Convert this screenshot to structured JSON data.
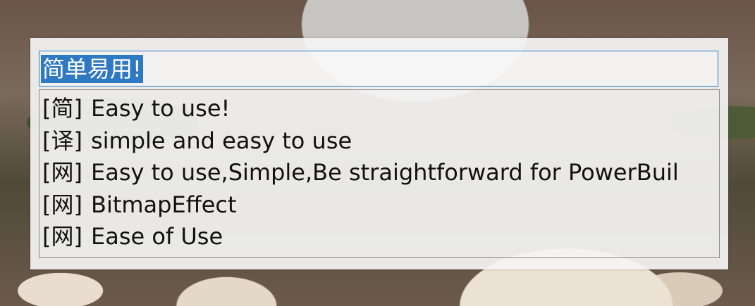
{
  "translator": {
    "query": "简单易用!",
    "results": [
      {
        "tag": "[简]",
        "text": "Easy to use!"
      },
      {
        "tag": "[译]",
        "text": "simple and easy to use"
      },
      {
        "tag": "[网]",
        "text": "Easy to use,Simple,Be straightforward for PowerBuil"
      },
      {
        "tag": "[网]",
        "text": "BitmapEffect"
      },
      {
        "tag": "[网]",
        "text": "Ease of Use"
      }
    ]
  }
}
